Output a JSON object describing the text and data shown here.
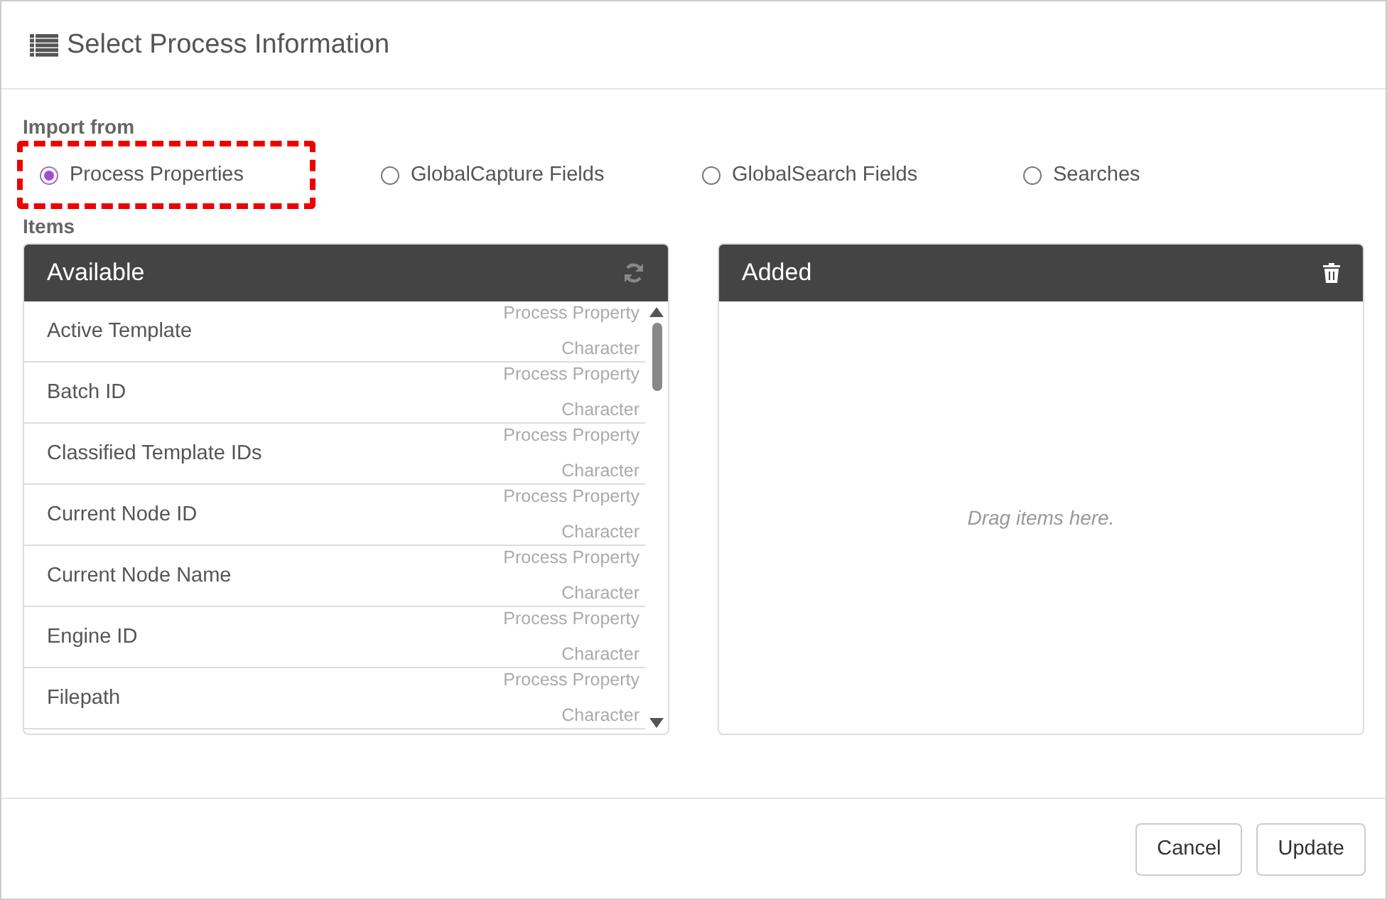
{
  "dialog": {
    "title": "Select Process Information"
  },
  "import_from": {
    "label": "Import from",
    "options": [
      {
        "label": "Process Properties",
        "selected": true,
        "highlighted": true
      },
      {
        "label": "GlobalCapture Fields",
        "selected": false,
        "highlighted": false
      },
      {
        "label": "GlobalSearch Fields",
        "selected": false,
        "highlighted": false
      },
      {
        "label": "Searches",
        "selected": false,
        "highlighted": false
      }
    ]
  },
  "items_label": "Items",
  "available": {
    "title": "Available",
    "items": [
      {
        "name": "Active Template",
        "source": "Process Property",
        "type": "Character"
      },
      {
        "name": "Batch ID",
        "source": "Process Property",
        "type": "Character"
      },
      {
        "name": "Classified Template IDs",
        "source": "Process Property",
        "type": "Character"
      },
      {
        "name": "Current Node ID",
        "source": "Process Property",
        "type": "Character"
      },
      {
        "name": "Current Node Name",
        "source": "Process Property",
        "type": "Character"
      },
      {
        "name": "Engine ID",
        "source": "Process Property",
        "type": "Character"
      },
      {
        "name": "Filepath",
        "source": "Process Property",
        "type": "Character"
      }
    ]
  },
  "added": {
    "title": "Added",
    "placeholder": "Drag items here."
  },
  "buttons": [
    "Cancel",
    "Update"
  ]
}
